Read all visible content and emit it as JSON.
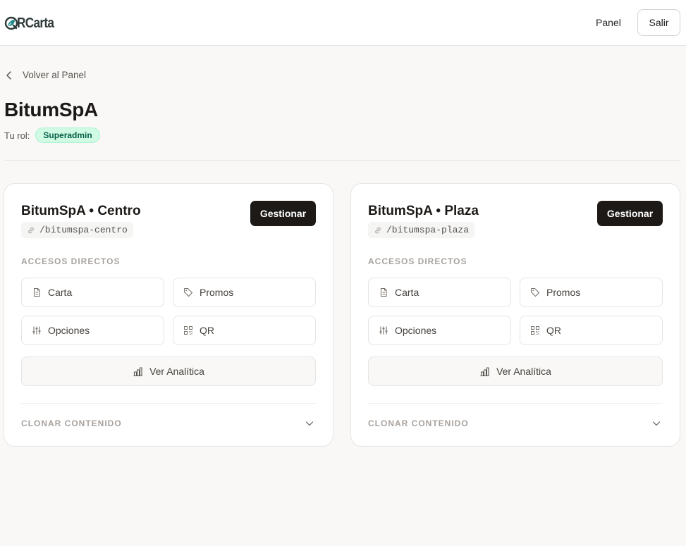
{
  "header": {
    "logo_text": "RCarta",
    "nav_panel": "Panel",
    "logout": "Salir"
  },
  "page": {
    "back": "Volver al Panel",
    "title": "BitumSpA",
    "role_label": "Tu rol:",
    "role_badge": "Superadmin"
  },
  "cards": [
    {
      "title": "BitumSpA • Centro",
      "slug": "/bitumspa-centro",
      "manage": "Gestionar",
      "shortcuts_label": "ACCESOS DIRECTOS",
      "carta": "Carta",
      "promos": "Promos",
      "opciones": "Opciones",
      "qr": "QR",
      "analytics": "Ver Analítica",
      "clone": "CLONAR CONTENIDO"
    },
    {
      "title": "BitumSpA • Plaza",
      "slug": "/bitumspa-plaza",
      "manage": "Gestionar",
      "shortcuts_label": "ACCESOS DIRECTOS",
      "carta": "Carta",
      "promos": "Promos",
      "opciones": "Opciones",
      "qr": "QR",
      "analytics": "Ver Analítica",
      "clone": "CLONAR CONTENIDO"
    }
  ],
  "colors": {
    "background": "#f9f8f6",
    "primary_button": "#1c1917",
    "badge_bg": "#d1fae5",
    "badge_text": "#065f46",
    "logo_accent": "#1f8a8a"
  },
  "icons": {
    "logo": "qr-leaf-logo-icon",
    "back": "chevron-left-icon",
    "slug": "link-icon",
    "carta": "document-icon",
    "promos": "tag-icon",
    "opciones": "sliders-icon",
    "qr": "qr-code-icon",
    "analytics": "bar-chart-icon",
    "clone": "chevron-down-icon"
  }
}
